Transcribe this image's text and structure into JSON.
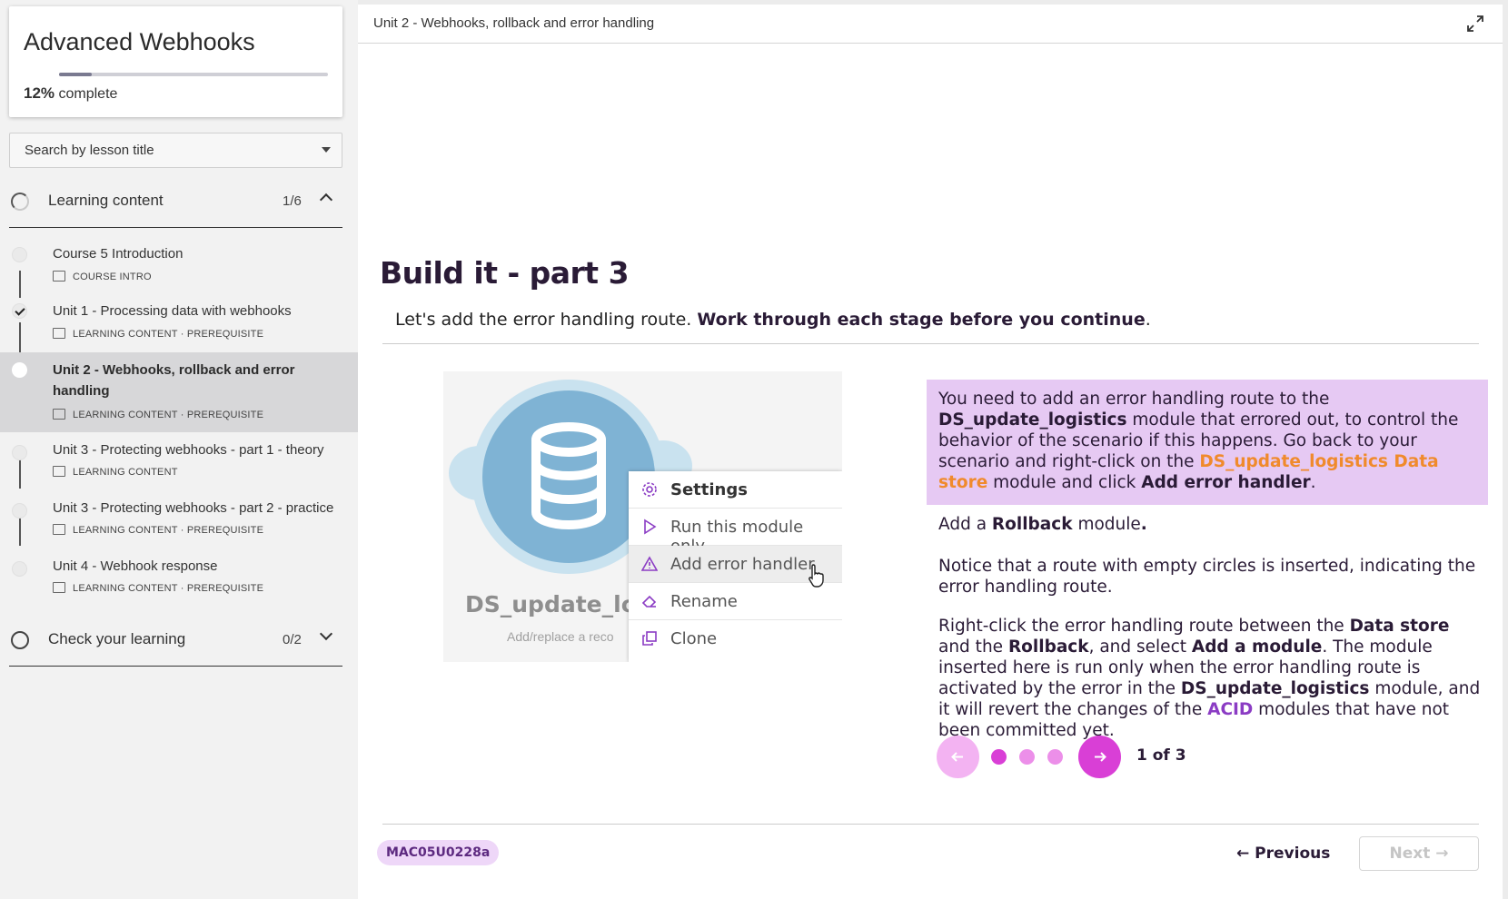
{
  "sidebar": {
    "course_title": "Advanced Webhooks",
    "progress_percent": "12%",
    "progress_fraction": 0.12,
    "progress_suffix": "complete",
    "search_placeholder": "Search by lesson title",
    "sections": [
      {
        "title": "Learning content",
        "count": "1/6"
      },
      {
        "title": "Check your learning",
        "count": "0/2"
      }
    ],
    "lessons": [
      {
        "title": "Course 5 Introduction",
        "meta": "COURSE INTRO",
        "status": "not-started"
      },
      {
        "title": "Unit 1 - Processing data with webhooks",
        "meta": "LEARNING CONTENT · PREREQUISITE",
        "status": "completed"
      },
      {
        "title": "Unit 2 - Webhooks, rollback and error handling",
        "meta": "LEARNING CONTENT · PREREQUISITE",
        "status": "current"
      },
      {
        "title": "Unit 3 - Protecting webhooks - part 1 - theory",
        "meta": "LEARNING CONTENT",
        "status": "not-started"
      },
      {
        "title": "Unit 3 - Protecting webhooks - part 2 - practice",
        "meta": "LEARNING CONTENT · PREREQUISITE",
        "status": "not-started"
      },
      {
        "title": "Unit 4 - Webhook response",
        "meta": "LEARNING CONTENT · PREREQUISITE",
        "status": "not-started"
      }
    ]
  },
  "main": {
    "breadcrumb": "Unit 2 - Webhooks, rollback and error handling",
    "heading": "Build it - part 3",
    "intro_plain": "Let's add the error handling route. ",
    "intro_bold": "Work through each stage before you continue",
    "intro_end": ".",
    "illustration": {
      "module_name": "DS_update_log",
      "module_sub": "Add/replace a reco",
      "menu": [
        "Settings",
        "Run this module only",
        "Add error handler",
        "Rename",
        "Clone"
      ]
    },
    "step": {
      "callout": {
        "t1": "You need to add an error handling route to the ",
        "b1": "DS_update_logistics",
        "t2": " module that errored out, to control the behavior of the scenario if this happens. Go back to your scenario and right-click on the ",
        "o1": "DS_update_logistics Data store",
        "t3": " module and click ",
        "b2": "Add error handler",
        "t4": "."
      },
      "p1": {
        "t1": "Add a ",
        "b1": "Rollback",
        "t2": " module",
        "b2": "."
      },
      "p2": "Notice that a route with empty circles is inserted, indicating the error handling route.",
      "p3": {
        "t1": "Right-click the error handling route between the ",
        "b1": "Data store",
        "t2": " and the ",
        "b2": "Rollback",
        "t3": ", and select ",
        "b3": "Add a module",
        "t4": ". The module inserted here is run only when the error handling route is activated by the error in the ",
        "b4": "DS_update_logistics",
        "t5": " module, and it will revert the changes of the ",
        "p1": "ACID",
        "t6": " modules that have not been committed yet."
      },
      "pager": "1 of 3",
      "current_step": 1,
      "total_steps": 3
    },
    "footer": {
      "code": "MAC05U0228a",
      "previous": "← Previous",
      "next": "Next →"
    }
  },
  "colors": {
    "callout_bg": "#e6c9f3",
    "accent_magenta": "#d93fd6",
    "accent_light": "#f3b3f2",
    "orange_link": "#f08a2c",
    "purple_link": "#8b3cc4"
  }
}
